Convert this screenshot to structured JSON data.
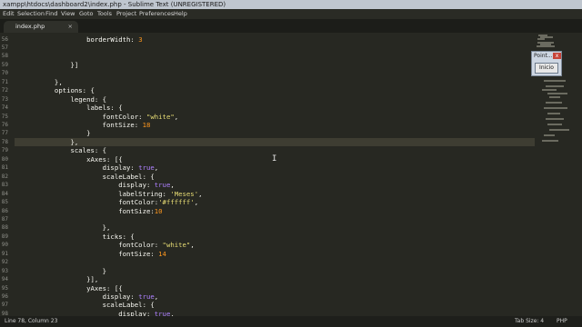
{
  "window": {
    "title": "xampp\\htdocs\\dashboard2\\index.php - Sublime Text (UNREGISTERED)"
  },
  "menu": [
    "Edit",
    "Selection",
    "Find",
    "View",
    "Goto",
    "Tools",
    "Project",
    "Preferences",
    "Help"
  ],
  "tab": {
    "label": "index.php",
    "close": "×"
  },
  "line_numbers": [
    "56",
    "57",
    "58",
    "59",
    "70",
    "71",
    "72",
    "73",
    "74",
    "75",
    "76",
    "77",
    "78",
    "79",
    "80",
    "81",
    "82",
    "83",
    "84",
    "85",
    "86",
    "87",
    "88",
    "89",
    "90",
    "91",
    "92",
    "93",
    "94",
    "95",
    "96",
    "97",
    "98",
    "99"
  ],
  "code": [
    [
      {
        "t": "                  borderWidth: ",
        "c": "b"
      },
      {
        "t": "3",
        "c": "n"
      }
    ],
    [],
    [],
    [
      {
        "t": "              }]",
        "c": "b"
      }
    ],
    [],
    [
      {
        "t": "          },",
        "c": "b"
      }
    ],
    [
      {
        "t": "          options: {",
        "c": "b"
      }
    ],
    [
      {
        "t": "              legend: {",
        "c": "b"
      }
    ],
    [
      {
        "t": "                  labels: {",
        "c": "b"
      }
    ],
    [
      {
        "t": "                      fontColor: ",
        "c": "b"
      },
      {
        "t": "\"white\"",
        "c": "s"
      },
      {
        "t": ",",
        "c": "b"
      }
    ],
    [
      {
        "t": "                      fontSize: ",
        "c": "b"
      },
      {
        "t": "18",
        "c": "n"
      }
    ],
    [
      {
        "t": "                  }",
        "c": "b"
      }
    ],
    [
      {
        "t": "              },",
        "c": "b"
      }
    ],
    [
      {
        "t": "              scales: {",
        "c": "b"
      }
    ],
    [
      {
        "t": "                  xAxes: [{",
        "c": "b"
      }
    ],
    [
      {
        "t": "                      display: ",
        "c": "b"
      },
      {
        "t": "true",
        "c": "k"
      },
      {
        "t": ",",
        "c": "b"
      }
    ],
    [
      {
        "t": "                      scaleLabel: {",
        "c": "b"
      }
    ],
    [
      {
        "t": "                          display: ",
        "c": "b"
      },
      {
        "t": "true",
        "c": "k"
      },
      {
        "t": ",",
        "c": "b"
      }
    ],
    [
      {
        "t": "                          labelString: ",
        "c": "b"
      },
      {
        "t": "'Meses'",
        "c": "s"
      },
      {
        "t": ",",
        "c": "b"
      }
    ],
    [
      {
        "t": "                          fontColor:",
        "c": "b"
      },
      {
        "t": "'#ffffff'",
        "c": "s"
      },
      {
        "t": ",",
        "c": "b"
      }
    ],
    [
      {
        "t": "                          fontSize:",
        "c": "b"
      },
      {
        "t": "10",
        "c": "n"
      }
    ],
    [],
    [
      {
        "t": "                      },",
        "c": "b"
      }
    ],
    [
      {
        "t": "                      ticks: {",
        "c": "b"
      }
    ],
    [
      {
        "t": "                          fontColor: ",
        "c": "b"
      },
      {
        "t": "\"white\"",
        "c": "s"
      },
      {
        "t": ",",
        "c": "b"
      }
    ],
    [
      {
        "t": "                          fontSize: ",
        "c": "b"
      },
      {
        "t": "14",
        "c": "n"
      }
    ],
    [],
    [
      {
        "t": "                      }",
        "c": "b"
      }
    ],
    [
      {
        "t": "                  }],",
        "c": "b"
      }
    ],
    [
      {
        "t": "                  yAxes: [{",
        "c": "b"
      }
    ],
    [
      {
        "t": "                      display: ",
        "c": "b"
      },
      {
        "t": "true",
        "c": "k"
      },
      {
        "t": ",",
        "c": "b"
      }
    ],
    [
      {
        "t": "                      scaleLabel: {",
        "c": "b"
      }
    ],
    [
      {
        "t": "                          display: ",
        "c": "b"
      },
      {
        "t": "true",
        "c": "k"
      },
      {
        "t": ",",
        "c": "b"
      }
    ]
  ],
  "active_line_index": 12,
  "popup": {
    "title": "Point...",
    "close": "x",
    "button": "Inicio"
  },
  "status": {
    "position": "Line 78, Column 23",
    "tab_size": "Tab Size: 4",
    "language": "PHP"
  },
  "colors": {
    "background": "#272822",
    "plain": "#f8f8f2",
    "keyword": "#ae81ff",
    "string": "#e6db74",
    "number": "#fd971f"
  }
}
